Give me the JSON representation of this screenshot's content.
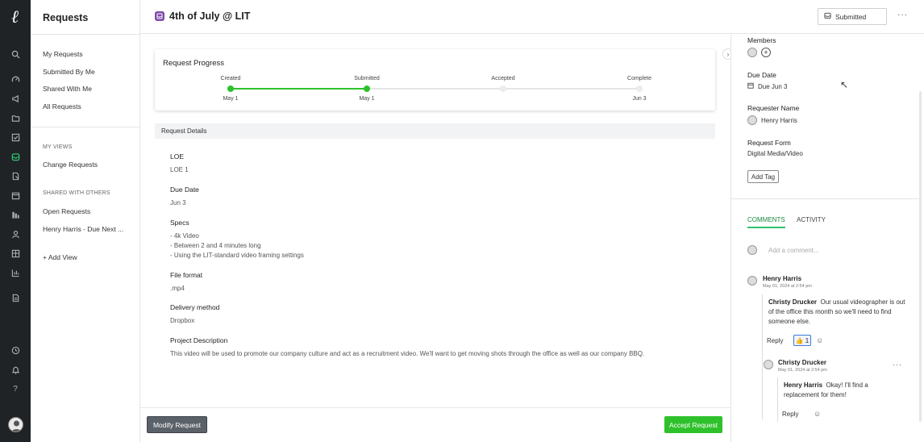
{
  "rail": {
    "icons": [
      "logo-icon",
      "search-icon",
      "dashboard-icon",
      "announce-icon",
      "folder-icon",
      "checklist-icon",
      "requests-icon",
      "file-icon",
      "calendar-icon",
      "board-icon",
      "person-icon",
      "table-icon",
      "chart-icon",
      "document-icon",
      "clock-icon",
      "bell-icon",
      "help-icon"
    ],
    "help_label": "?",
    "active_color": "#2fc26b"
  },
  "subnav": {
    "title": "Requests",
    "items": [
      "My Requests",
      "Submitted By Me",
      "Shared With Me",
      "All Requests"
    ],
    "my_views_heading": "MY VIEWS",
    "my_views": [
      "Change Requests"
    ],
    "shared_heading": "SHARED WITH OTHERS",
    "shared": [
      "Open Requests",
      "Henry Harris - Due Next ..."
    ],
    "add_view": "+ Add View"
  },
  "header": {
    "title": "4th of July @ LIT",
    "status": "Submitted",
    "more": "···"
  },
  "progress": {
    "title": "Request Progress",
    "stages": [
      {
        "label": "Created",
        "date": "May 1",
        "done": true
      },
      {
        "label": "Submitted",
        "date": "May 1",
        "done": true
      },
      {
        "label": "Accepted",
        "date": "",
        "done": false
      },
      {
        "label": "Complete",
        "date": "Jun 3",
        "done": false
      }
    ],
    "accent": "#2fc12c"
  },
  "details": {
    "heading": "Request Details",
    "fields": [
      {
        "label": "LOE",
        "value": "LOE 1"
      },
      {
        "label": "Due Date",
        "value": "Jun 3"
      },
      {
        "label": "Specs",
        "value": "- 4k Video\n- Between 2 and 4 minutes long\n- Using the LIT-standard video framing settings"
      },
      {
        "label": "File format",
        "value": ".mp4"
      },
      {
        "label": "Delivery method",
        "value": "Dropbox"
      },
      {
        "label": "Project Description",
        "value": "This video will be used to promote our company culture and act as a recruitment video. We'll want to get moving shots through the office as well as our company BBQ."
      }
    ]
  },
  "footer": {
    "modify": "Modify Request",
    "accept": "Accept Request"
  },
  "side": {
    "members_label": "Members",
    "due_label": "Due Date",
    "due_value": "Due Jun 3",
    "requester_label": "Requester Name",
    "requester_value": "Henry Harris",
    "form_label": "Request Form",
    "form_value": "Digital Media/Video",
    "add_tag": "Add Tag",
    "tabs": [
      "COMMENTS",
      "ACTIVITY"
    ],
    "comment_placeholder": "Add a comment...",
    "comments": [
      {
        "author": "Henry Harris",
        "time": "May 01, 2024 at 2:54 pm",
        "mention": "Christy Drucker",
        "text": "Our usual videographer is out of the office this month so we'll need to find someone else.",
        "reply": "Reply",
        "reaction_count": "1"
      },
      {
        "author": "Christy Drucker",
        "time": "May 01, 2024 at 2:54 pm",
        "mention": "Henry Harris",
        "text": "Okay! I'll find a replacement for them!",
        "reply": "Reply"
      }
    ],
    "more": "···"
  }
}
